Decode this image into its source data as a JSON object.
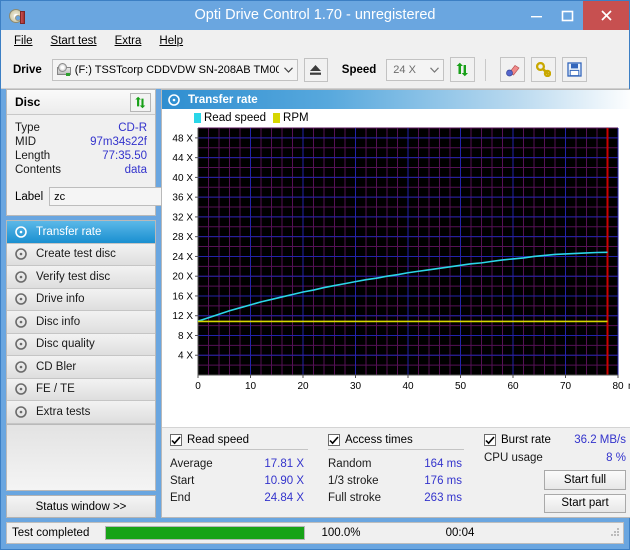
{
  "window": {
    "title": "Opti Drive Control 1.70 - unregistered",
    "app_icon": "cd-disc-icon",
    "minimize_label": "Minimize",
    "maximize_label": "Maximize",
    "close_label": "Close"
  },
  "menubar": {
    "items": [
      {
        "label": "File",
        "accel": "F"
      },
      {
        "label": "Start test",
        "accel": "S"
      },
      {
        "label": "Extra",
        "accel": "x"
      },
      {
        "label": "Help",
        "accel": "H"
      }
    ]
  },
  "toolbar": {
    "drive_label": "Drive",
    "drive_value": "(F:)  TSSTcorp CDDVDW SN-208AB TM00",
    "eject_icon": "eject-icon",
    "speed_label": "Speed",
    "speed_value": "24 X",
    "refresh_icon": "refresh-icon",
    "eraser_icon": "eraser-icon",
    "key_icon": "key-icon",
    "save_icon": "save-icon"
  },
  "disc": {
    "title": "Disc",
    "refresh_icon": "refresh-icon",
    "rows": [
      {
        "key": "Type",
        "value": "CD-R"
      },
      {
        "key": "MID",
        "value": "97m34s22f"
      },
      {
        "key": "Length",
        "value": "77:35.50"
      },
      {
        "key": "Contents",
        "value": "data"
      }
    ],
    "label_key": "Label",
    "label_value": "zc",
    "label_placeholder": "",
    "label_button_icon": "cd-disc-icon"
  },
  "sidebar": {
    "items": [
      {
        "label": "Transfer rate",
        "icon": "disc-icon",
        "active": true
      },
      {
        "label": "Create test disc",
        "icon": "disc-icon",
        "active": false
      },
      {
        "label": "Verify test disc",
        "icon": "disc-icon",
        "active": false
      },
      {
        "label": "Drive info",
        "icon": "disc-icon",
        "active": false
      },
      {
        "label": "Disc info",
        "icon": "disc-icon",
        "active": false
      },
      {
        "label": "Disc quality",
        "icon": "disc-icon",
        "active": false
      },
      {
        "label": "CD Bler",
        "icon": "disc-icon",
        "active": false
      },
      {
        "label": "FE / TE",
        "icon": "disc-icon",
        "active": false
      },
      {
        "label": "Extra tests",
        "icon": "disc-icon",
        "active": false
      }
    ],
    "status_window_label": "Status window >>"
  },
  "panel": {
    "title": "Transfer rate",
    "icon": "disc-icon"
  },
  "chart_data": {
    "type": "line",
    "title": "Transfer rate",
    "xlabel": "min",
    "ylabel": "X",
    "xlim": [
      0,
      80
    ],
    "ylim": [
      0,
      50
    ],
    "grid": true,
    "background": "#000000",
    "grid_color_major": "#2222aa",
    "grid_color_minor": "#551155",
    "legend_position": "top-left",
    "x_ticks": [
      0,
      10,
      20,
      30,
      40,
      50,
      60,
      70,
      80
    ],
    "x_tick_labels": [
      "0",
      "10",
      "20",
      "30",
      "40",
      "50",
      "60",
      "70",
      "80"
    ],
    "x_axis_unit": "min",
    "y_ticks": [
      4,
      8,
      12,
      16,
      20,
      24,
      28,
      32,
      36,
      40,
      44,
      48
    ],
    "y_tick_labels": [
      "4 X",
      "8 X",
      "12 X",
      "16 X",
      "20 X",
      "24 X",
      "28 X",
      "32 X",
      "36 X",
      "40 X",
      "44 X",
      "48 X"
    ],
    "end_marker_x": 78,
    "end_marker_color": "#cc0000",
    "series": [
      {
        "name": "Read speed",
        "color": "#2ad6e8",
        "x": [
          0,
          2,
          4,
          6,
          8,
          10,
          12,
          14,
          16,
          18,
          20,
          22,
          24,
          26,
          28,
          30,
          32,
          34,
          36,
          38,
          40,
          42,
          44,
          46,
          48,
          50,
          52,
          54,
          56,
          58,
          60,
          62,
          64,
          66,
          68,
          70,
          72,
          74,
          76,
          78
        ],
        "values": [
          10.9,
          11.6,
          12.3,
          13.0,
          13.6,
          14.2,
          14.8,
          15.3,
          15.8,
          16.3,
          16.8,
          17.2,
          17.7,
          18.1,
          18.5,
          18.9,
          19.3,
          19.6,
          20.0,
          20.3,
          20.7,
          21.0,
          21.3,
          21.6,
          21.9,
          22.2,
          22.5,
          22.7,
          23.0,
          23.3,
          23.5,
          23.7,
          24.0,
          24.2,
          24.4,
          24.5,
          24.6,
          24.7,
          24.8,
          24.84
        ]
      },
      {
        "name": "RPM",
        "color": "#d6d600",
        "x": [
          0,
          78
        ],
        "values": [
          10.85,
          10.85
        ]
      }
    ]
  },
  "stats": {
    "read_speed": {
      "checkbox_label": "Read speed",
      "checked": true,
      "rows": [
        {
          "key": "Average",
          "value": "17.81 X"
        },
        {
          "key": "Start",
          "value": "10.90 X"
        },
        {
          "key": "End",
          "value": "24.84 X"
        }
      ]
    },
    "access_times": {
      "checkbox_label": "Access times",
      "checked": true,
      "rows": [
        {
          "key": "Random",
          "value": "164 ms"
        },
        {
          "key": "1/3 stroke",
          "value": "176 ms"
        },
        {
          "key": "Full stroke",
          "value": "263 ms"
        }
      ]
    },
    "burst": {
      "checkbox_label": "Burst rate",
      "checked": true,
      "burst_value": "36.2 MB/s",
      "cpu_key": "CPU usage",
      "cpu_value": "8 %",
      "start_full_label": "Start full",
      "start_part_label": "Start part"
    }
  },
  "statusbar": {
    "message": "Test completed",
    "progress_percent": 100,
    "progress_label": "100.0%",
    "elapsed": "00:04",
    "progress_color": "#17a317"
  }
}
